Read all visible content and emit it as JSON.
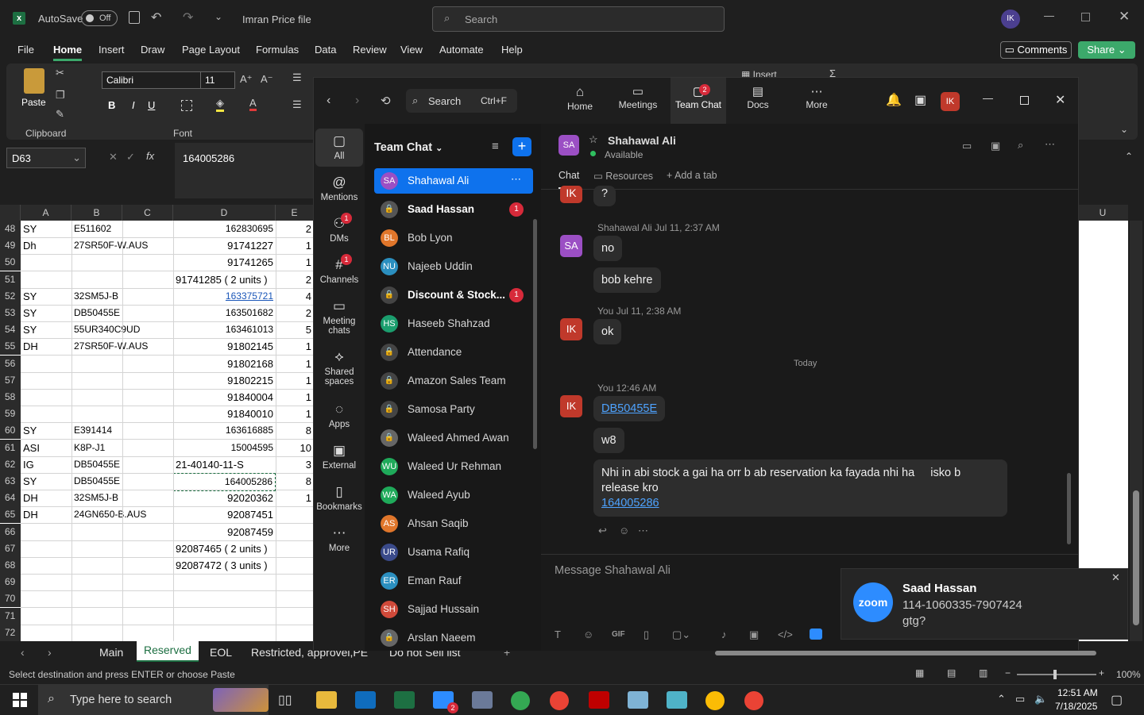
{
  "excel": {
    "autosave": "AutoSave",
    "autosave_state": "Off",
    "file_title": "Imran Price file",
    "search_placeholder": "Search",
    "user_initials": "IK",
    "menu": [
      "File",
      "Home",
      "Insert",
      "Draw",
      "Page Layout",
      "Formulas",
      "Data",
      "Review",
      "View",
      "Automate",
      "Help"
    ],
    "comments": "Comments",
    "share": "Share",
    "ribbon": {
      "paste": "Paste",
      "clipboard": "Clipboard",
      "font_name": "Calibri",
      "font_size": "11",
      "font_group": "Font",
      "bold": "B",
      "italic": "I",
      "underline": "U",
      "insert": "Insert"
    },
    "name_box": "D63",
    "formula": "164005286",
    "columns": [
      "A",
      "B",
      "C",
      "D",
      "E",
      "U"
    ],
    "rows": [
      {
        "n": "48",
        "a": "SY",
        "b": "E511602",
        "d": "162830695",
        "e": "2"
      },
      {
        "n": "49",
        "a": "Dh",
        "b": "27SR50F-W.AUS",
        "d": "91741227",
        "e": "1"
      },
      {
        "n": "50",
        "a": "",
        "b": "",
        "d": "91741265",
        "e": "1"
      },
      {
        "n": "51",
        "a": "",
        "b": "",
        "d": "91741285 ( 2 units )",
        "e": "2"
      },
      {
        "n": "52",
        "a": "SY",
        "b": "32SM5J-B",
        "d": "163375721",
        "e": "4"
      },
      {
        "n": "53",
        "a": "SY",
        "b": "DB50455E",
        "d": "163501682",
        "e": "2"
      },
      {
        "n": "54",
        "a": "SY",
        "b": "55UR340C9UD",
        "d": "163461013",
        "e": "5"
      },
      {
        "n": "55",
        "a": "DH",
        "b": "27SR50F-W.AUS",
        "d": "91802145",
        "e": "1"
      },
      {
        "n": "56",
        "a": "",
        "b": "",
        "d": "91802168",
        "e": "1"
      },
      {
        "n": "57",
        "a": "",
        "b": "",
        "d": "91802215",
        "e": "1"
      },
      {
        "n": "58",
        "a": "",
        "b": "",
        "d": "91840004",
        "e": "1"
      },
      {
        "n": "59",
        "a": "",
        "b": "",
        "d": "91840010",
        "e": "1"
      },
      {
        "n": "60",
        "a": "SY",
        "b": "E391414",
        "d": "163616885",
        "e": "8"
      },
      {
        "n": "61",
        "a": "ASI",
        "b": "K8P-J1",
        "d": "15004595",
        "e": "10"
      },
      {
        "n": "62",
        "a": "IG",
        "b": "DB50455E",
        "d": "21-40140-11-S",
        "e": "3"
      },
      {
        "n": "63",
        "a": "SY",
        "b": "DB50455E",
        "d": "164005286",
        "e": "8"
      },
      {
        "n": "64",
        "a": "DH",
        "b": "32SM5J-B",
        "d": "92020362",
        "e": "1"
      },
      {
        "n": "65",
        "a": "DH",
        "b": "24GN650-B.AUS",
        "d": "92087451",
        "e": ""
      },
      {
        "n": "66",
        "a": "",
        "b": "",
        "d": "92087459",
        "e": ""
      },
      {
        "n": "67",
        "a": "",
        "b": "",
        "d": "92087465 ( 2 units )",
        "e": ""
      },
      {
        "n": "68",
        "a": "",
        "b": "",
        "d": "92087472 ( 3 units )",
        "e": ""
      },
      {
        "n": "69",
        "a": "",
        "b": "",
        "d": "",
        "e": ""
      },
      {
        "n": "70",
        "a": "",
        "b": "",
        "d": "",
        "e": ""
      },
      {
        "n": "71",
        "a": "",
        "b": "",
        "d": "",
        "e": ""
      },
      {
        "n": "72",
        "a": "",
        "b": "",
        "d": "",
        "e": ""
      }
    ],
    "sheets": [
      "Main",
      "Reserved",
      "EOL",
      "Restricted, approvel,PE",
      "Do not Sell list"
    ],
    "status": "Select destination and press ENTER or choose Paste",
    "zoom": "100%"
  },
  "zoom_app": {
    "search": "Search",
    "shortcut": "Ctrl+F",
    "nav": [
      "Home",
      "Meetings",
      "Team Chat",
      "Docs",
      "More"
    ],
    "team_chat_badge": "2",
    "user_initials": "IK",
    "rail": [
      "All",
      "Mentions",
      "DMs",
      "Channels",
      "Meeting chats",
      "Shared spaces",
      "Apps",
      "External",
      "Bookmarks",
      "More"
    ],
    "dm_badge": "1",
    "channels_badge": "1",
    "list_title": "Team Chat",
    "chats": [
      {
        "name": "Shahawal Ali",
        "initials": "SA",
        "color": "#9b4fc4"
      },
      {
        "name": "Saad Hassan",
        "initials": "",
        "color": "#555",
        "badge": "1"
      },
      {
        "name": "Bob Lyon",
        "initials": "BL",
        "color": "#e0762b"
      },
      {
        "name": "Najeeb Uddin",
        "initials": "NU",
        "color": "#2b8fbf"
      },
      {
        "name": "Discount & Stock...",
        "initials": "",
        "color": "#444",
        "badge": "1"
      },
      {
        "name": "Haseeb Shahzad",
        "initials": "HS",
        "color": "#1b9e6e"
      },
      {
        "name": "Attendance",
        "initials": "",
        "color": "#444"
      },
      {
        "name": "Amazon Sales Team",
        "initials": "",
        "color": "#444"
      },
      {
        "name": "Samosa Party",
        "initials": "",
        "color": "#444"
      },
      {
        "name": "Waleed Ahmed Awan",
        "initials": "",
        "color": "#666"
      },
      {
        "name": "Waleed Ur Rehman",
        "initials": "WU",
        "color": "#1faa5a"
      },
      {
        "name": "Waleed Ayub",
        "initials": "WA",
        "color": "#1faa5a"
      },
      {
        "name": "Ahsan Saqib",
        "initials": "AS",
        "color": "#e0762b"
      },
      {
        "name": "Usama Rafiq",
        "initials": "UR",
        "color": "#3a4a8a"
      },
      {
        "name": "Eman Rauf",
        "initials": "ER",
        "color": "#2b8fbf"
      },
      {
        "name": "Sajjad Hussain",
        "initials": "SH",
        "color": "#d04a3a"
      },
      {
        "name": "Arslan Naeem",
        "initials": "",
        "color": "#666"
      }
    ],
    "conversation": {
      "name": "Shahawal Ali",
      "status": "Available",
      "initials": "SA",
      "tabs": [
        "Chat",
        "Resources",
        "Add a tab"
      ],
      "messages": {
        "q": "?",
        "m1_meta": "Shahawal Ali Jul 11, 2:37 AM",
        "m1a": "no",
        "m1b": "bob kehre",
        "m2_meta": "You Jul 11, 2:38 AM",
        "m2": "ok",
        "divider": "Today",
        "m3_meta": "You 12:46 AM",
        "m3a": "DB50455E",
        "m3b": "w8",
        "m3c": "Nhi in abi stock a gai ha orr b ab reservation ka fayada nhi ha     isko b release kro",
        "m3d": "164005286"
      },
      "composer_placeholder": "Message Shahawal Ali"
    },
    "toast": {
      "brand": "zoom",
      "title": "Saad Hassan",
      "line1": "114-1060335-7907424",
      "line2": "gtg?"
    }
  },
  "taskbar": {
    "search": "Type here to search",
    "time": "12:51 AM",
    "date": "7/18/2025",
    "zoom_badge": "2"
  }
}
